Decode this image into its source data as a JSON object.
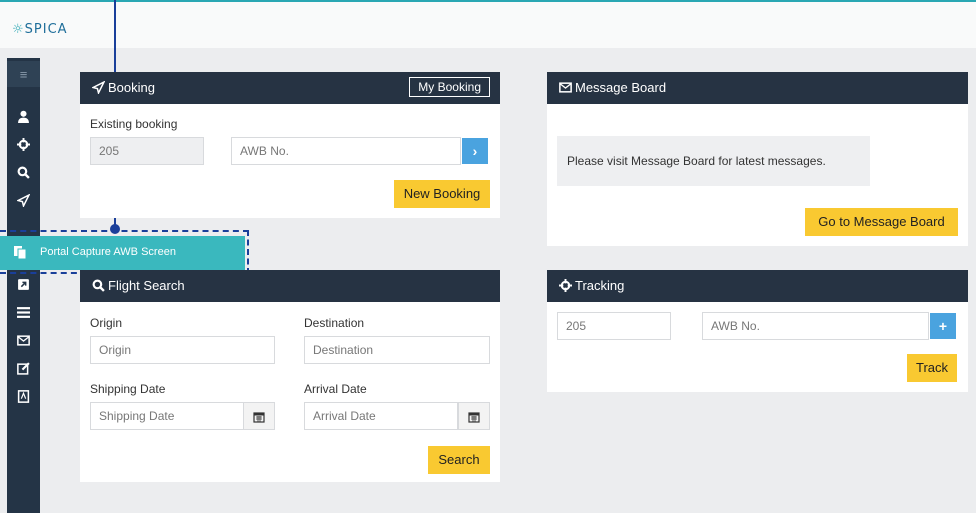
{
  "app": {
    "logo_text": "SPICA"
  },
  "callout": {
    "label": "Portal Capture AWB Screen"
  },
  "booking": {
    "title": "Booking",
    "my_booking": "My Booking",
    "existing_label": "Existing booking",
    "prefix_value": "205",
    "awb_placeholder": "AWB No.",
    "go_icon": "chevron-right-icon",
    "new_booking": "New Booking"
  },
  "message_board": {
    "title": "Message Board",
    "message": "Please visit Message Board for latest messages.",
    "button": "Go to Message Board"
  },
  "flight_search": {
    "title": "Flight Search",
    "origin_label": "Origin",
    "origin_placeholder": "Origin",
    "destination_label": "Destination",
    "destination_placeholder": "Destination",
    "shipping_label": "Shipping Date",
    "shipping_placeholder": "Shipping Date",
    "arrival_label": "Arrival Date",
    "arrival_placeholder": "Arrival Date",
    "search_button": "Search"
  },
  "tracking": {
    "title": "Tracking",
    "prefix_value": "205",
    "awb_placeholder": "AWB No.",
    "add_icon": "plus-icon",
    "track_button": "Track"
  },
  "sidebar": {
    "items": [
      "menu-icon",
      "user-icon",
      "crosshair-icon",
      "search-icon",
      "send-icon",
      "copy-icon",
      "external-link-icon",
      "list-icon",
      "envelope-icon",
      "edit-icon",
      "pdf-icon"
    ]
  },
  "colors": {
    "accent": "#2aa7b3",
    "header": "#263343",
    "button": "#f9c931",
    "callout": "#3ab8be",
    "annotation": "#1a3f9a"
  }
}
